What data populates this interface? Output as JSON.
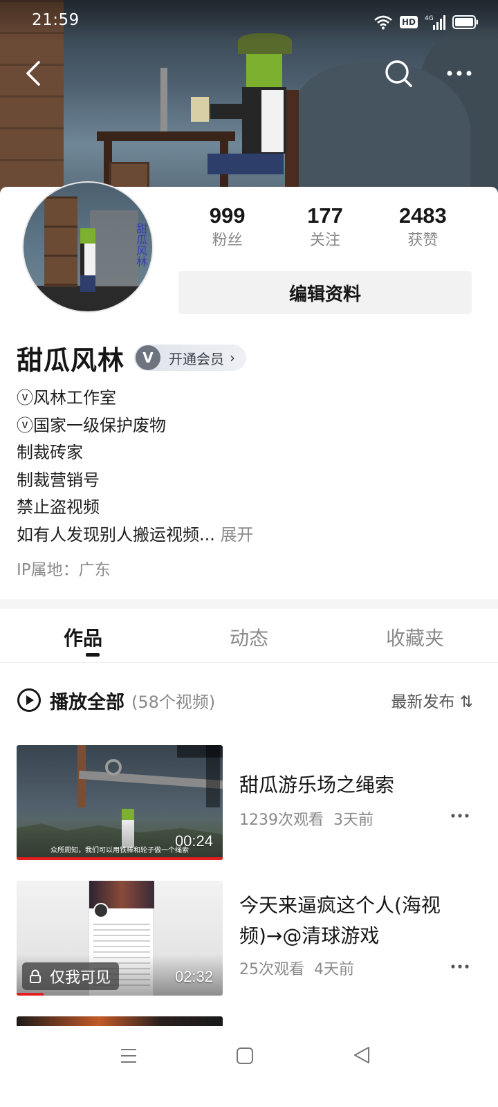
{
  "status_bar": {
    "time": "21:59",
    "hd_badge": "HD",
    "network_type": "4G"
  },
  "header": {
    "back_icon": "chevron-left-icon",
    "search_icon": "search-icon",
    "more_icon": "more-horizontal-icon"
  },
  "profile": {
    "stats": [
      {
        "value": "999",
        "label": "粉丝"
      },
      {
        "value": "177",
        "label": "关注"
      },
      {
        "value": "2483",
        "label": "获赞"
      }
    ],
    "edit_button_label": "编辑资料",
    "username": "甜瓜风林",
    "vip": {
      "icon_letter": "V",
      "label": "开通会员",
      "chevron": "›"
    },
    "avatar_sign": "甜瓜风林",
    "bio_lines": [
      "ⓥ风林工作室",
      "ⓥ国家一级保护废物",
      "制裁砖家",
      "制裁营销号",
      "禁止盗视频",
      "如有人发现别人搬运视频..."
    ],
    "bio_expand_label": "展开",
    "ip_location": "IP属地：广东"
  },
  "tabs": [
    {
      "label": "作品",
      "active": true
    },
    {
      "label": "动态",
      "active": false
    },
    {
      "label": "收藏夹",
      "active": false
    }
  ],
  "play_all": {
    "label": "播放全部",
    "count": "(58个视频)",
    "sort_label": "最新发布 ⇅"
  },
  "videos": [
    {
      "title": "甜瓜游乐场之绳索",
      "views": "1239次观看",
      "age": "3天前",
      "duration": "00:24",
      "caption": "众所周知，我们可以用铁棒和轮子做一个绳索",
      "progress": 1.0,
      "private": false
    },
    {
      "title_line1": "今天来逼疯这个人(海视",
      "title_line2": "频)→@清球游戏",
      "views": "25次观看",
      "age": "4天前",
      "duration": "02:32",
      "private_label": "仅我可见",
      "progress": 0.13,
      "private": true
    }
  ],
  "colors": {
    "accent_red": "#e02020",
    "text_primary": "#161616",
    "text_secondary": "#8a8a8a"
  }
}
